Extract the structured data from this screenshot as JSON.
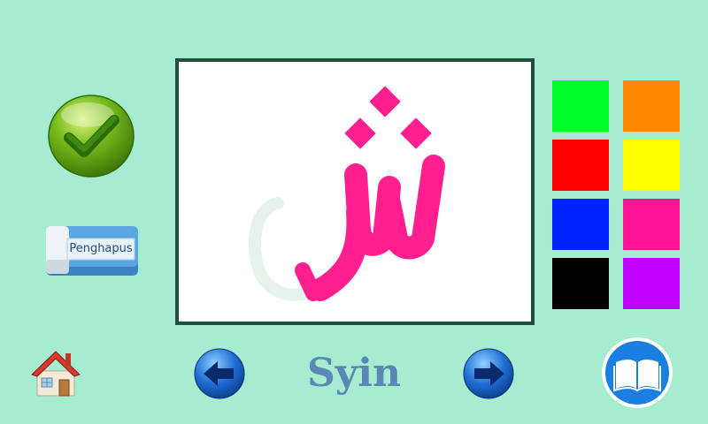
{
  "buttons": {
    "check": "check-icon",
    "eraser_label": "Penghapus",
    "home": "home-icon",
    "prev": "arrow-left-icon",
    "next": "arrow-right-icon",
    "book": "book-icon"
  },
  "letter": {
    "name": "Syin",
    "glyph": "ش",
    "trace_color": "#e8f4ee",
    "paint_color": "#ff1f8e"
  },
  "palette": [
    {
      "name": "green",
      "color": "#00ff2a"
    },
    {
      "name": "orange",
      "color": "#ff8800"
    },
    {
      "name": "red",
      "color": "#ff0000"
    },
    {
      "name": "yellow",
      "color": "#ffff00"
    },
    {
      "name": "blue",
      "color": "#0022ff"
    },
    {
      "name": "pink",
      "color": "#ff1493"
    },
    {
      "name": "black",
      "color": "#000000"
    },
    {
      "name": "purple",
      "color": "#c000ff"
    }
  ]
}
